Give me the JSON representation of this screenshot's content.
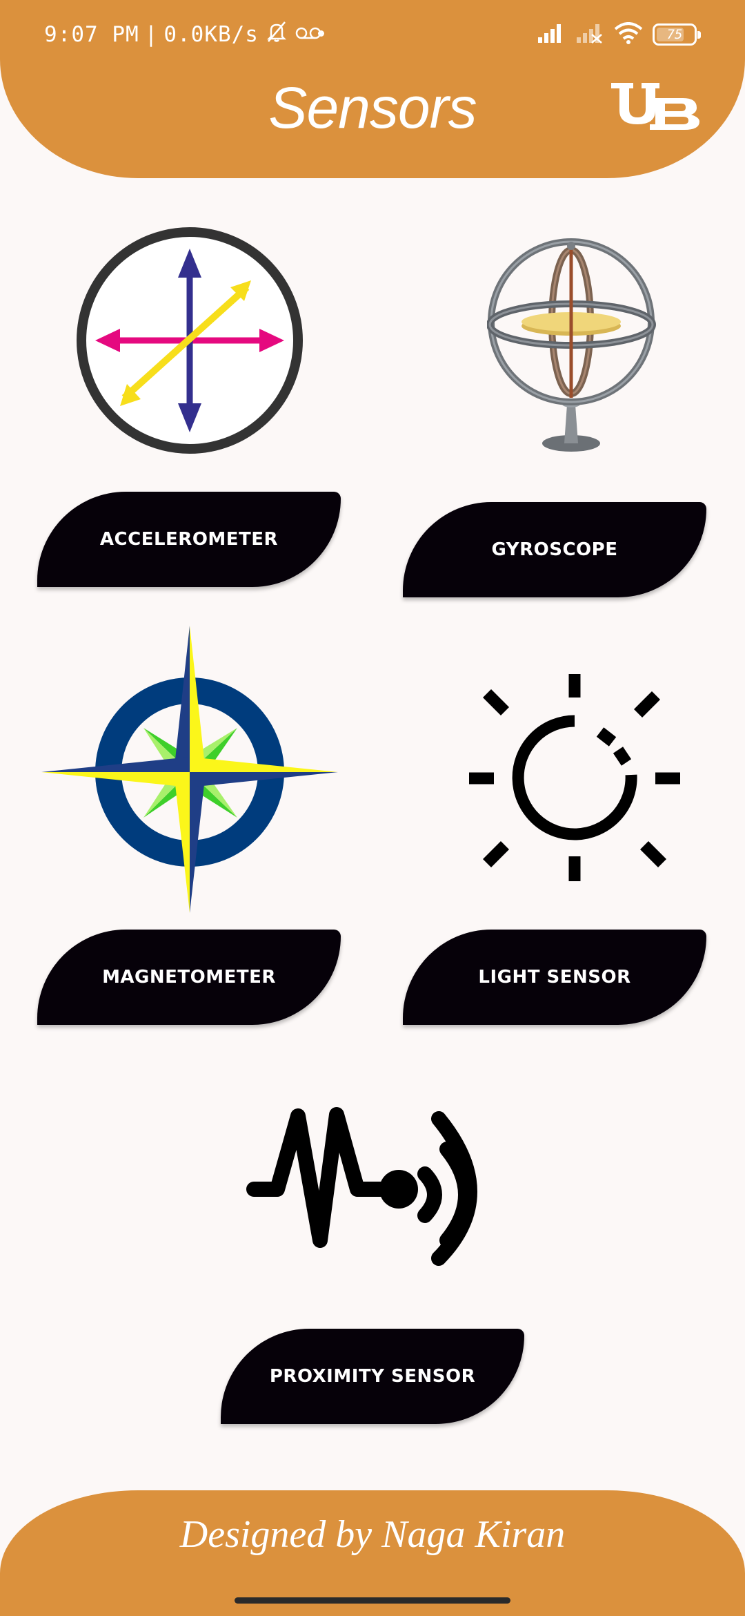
{
  "status_bar": {
    "time": "9:07 PM",
    "separator": "|",
    "network_speed": "0.0KB/s",
    "battery_level": "75",
    "battery_fraction": 0.75,
    "icons": [
      "mute-icon",
      "voicemail-icon",
      "signal-icon",
      "signal-x-icon",
      "wifi-icon",
      "battery-icon"
    ]
  },
  "header": {
    "title": "Sensors",
    "logo": "UB",
    "color": "#db913d"
  },
  "sensors": [
    {
      "label": "ACCELEROMETER",
      "icon": "accelerometer-icon"
    },
    {
      "label": "GYROSCOPE",
      "icon": "gyroscope-icon"
    },
    {
      "label": "MAGNETOMETER",
      "icon": "compass-icon"
    },
    {
      "label": "LIGHT SENSOR",
      "icon": "sun-icon"
    },
    {
      "label": "PROXIMITY SENSOR",
      "icon": "proximity-icon"
    }
  ],
  "footer": {
    "text": "Designed by Naga Kiran"
  },
  "colors": {
    "accent": "#db913d",
    "button": "#060109",
    "background": "#fcf8f7"
  }
}
